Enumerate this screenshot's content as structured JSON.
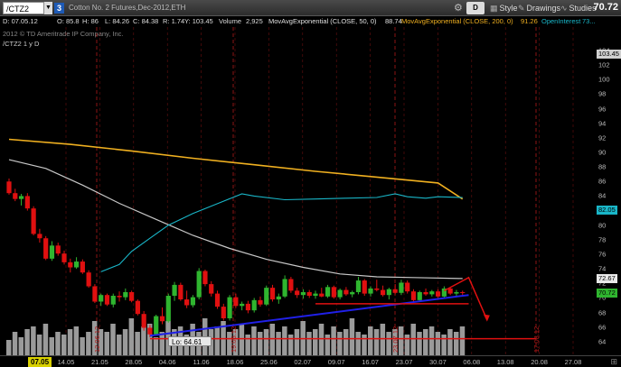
{
  "toolbar": {
    "symbol": "/CTZ2",
    "link_number": "3",
    "description": "Cotton No. 2 Futures,Dec-2012,ETH",
    "period": "D",
    "style_label": "Style",
    "drawings_label": "Drawings",
    "studies_label": "Studies",
    "last_price": "70.72"
  },
  "studybar": {
    "date": "D: 07.05.12",
    "open": "O: 85.8",
    "high": "H: 86",
    "low": "L: 84.26",
    "close": "C: 84.38",
    "range": "R: 1.74",
    "ytd": "Y: 103.45",
    "volume_label": "Volume",
    "volume_value": "2,925",
    "ma50_label": "MovAvgExponential (CLOSE, 50, 0)",
    "ma50_value": "88.74",
    "ma200_label": "MovAvgExponential (CLOSE, 200, 0)",
    "ma200_value": "91.26",
    "oi_label": "OpenInterest",
    "oi_value": "73..."
  },
  "copyright": "2012 © TD Ameritrade IP Company, Inc.",
  "chart_label": "/CTZ2 1 y D",
  "lo_label": "Lo: 64.61",
  "xaxis_first": "07.05",
  "corner_glyph": "⊞",
  "colors": {
    "up": "#2fb52f",
    "down": "#e01010",
    "ma50": "#f0b020",
    "ma200": "#c8c8c8",
    "openinterest": "#19b6c8",
    "trendline": "#2020e8",
    "volume": "#9a9a9a"
  },
  "chart_data": {
    "type": "candlestick",
    "y_range": [
      62,
      104
    ],
    "y_ticks": [
      "104",
      "102",
      "100",
      "98",
      "96",
      "94",
      "92",
      "90",
      "88",
      "86",
      "84",
      "82",
      "80",
      "78",
      "76",
      "74",
      "72",
      "70",
      "68",
      "66",
      "64"
    ],
    "x_ticks": [
      "14.05",
      "21.05",
      "28.05",
      "04.06",
      "11.06",
      "18.06",
      "25.06",
      "02.07",
      "09.07",
      "16.07",
      "23.07",
      "30.07",
      "06.08",
      "13.08",
      "20.08",
      "27.08"
    ],
    "price_tags": [
      {
        "value": 103.45,
        "label": "103.45",
        "bg": "#d0d0d0",
        "fg": "#000"
      },
      {
        "value": 82.05,
        "label": "82.05",
        "bg": "#19b6c8",
        "fg": "#000"
      },
      {
        "value": 72.67,
        "label": "72.67",
        "bg": "#e8e8e8",
        "fg": "#000"
      },
      {
        "value": 70.72,
        "label": "70.72",
        "bg": "#2fb52f",
        "fg": "#000"
      }
    ],
    "event_markers": [
      "12.06.12",
      "19.06.12",
      "23.07.12",
      "17.08.12"
    ],
    "candles": [
      {
        "o": 86.0,
        "h": 86.4,
        "l": 84.2,
        "c": 84.4
      },
      {
        "o": 84.4,
        "h": 85.0,
        "l": 83.3,
        "c": 83.6
      },
      {
        "o": 83.6,
        "h": 84.3,
        "l": 82.7,
        "c": 84.0
      },
      {
        "o": 84.0,
        "h": 84.4,
        "l": 82.0,
        "c": 82.3
      },
      {
        "o": 82.3,
        "h": 82.6,
        "l": 78.6,
        "c": 78.8
      },
      {
        "o": 78.8,
        "h": 79.5,
        "l": 77.6,
        "c": 78.2
      },
      {
        "o": 78.2,
        "h": 78.5,
        "l": 75.2,
        "c": 75.4
      },
      {
        "o": 75.4,
        "h": 77.8,
        "l": 75.1,
        "c": 77.2
      },
      {
        "o": 77.2,
        "h": 77.6,
        "l": 75.8,
        "c": 76.1
      },
      {
        "o": 76.1,
        "h": 76.5,
        "l": 74.6,
        "c": 74.9
      },
      {
        "o": 74.9,
        "h": 75.4,
        "l": 73.5,
        "c": 74.2
      },
      {
        "o": 74.2,
        "h": 75.6,
        "l": 74.0,
        "c": 75.0
      },
      {
        "o": 75.0,
        "h": 75.3,
        "l": 73.3,
        "c": 73.5
      },
      {
        "o": 73.5,
        "h": 73.8,
        "l": 71.4,
        "c": 71.6
      },
      {
        "o": 71.6,
        "h": 71.9,
        "l": 69.3,
        "c": 69.5
      },
      {
        "o": 69.5,
        "h": 70.6,
        "l": 68.9,
        "c": 70.4
      },
      {
        "o": 70.4,
        "h": 70.6,
        "l": 68.9,
        "c": 69.1
      },
      {
        "o": 69.1,
        "h": 70.6,
        "l": 68.7,
        "c": 70.3
      },
      {
        "o": 70.3,
        "h": 70.9,
        "l": 69.5,
        "c": 70.1
      },
      {
        "o": 70.1,
        "h": 71.3,
        "l": 69.7,
        "c": 70.8
      },
      {
        "o": 70.8,
        "h": 71.0,
        "l": 69.4,
        "c": 69.6
      },
      {
        "o": 69.6,
        "h": 69.8,
        "l": 67.6,
        "c": 67.8
      },
      {
        "o": 67.8,
        "h": 68.2,
        "l": 65.5,
        "c": 65.9
      },
      {
        "o": 65.9,
        "h": 66.3,
        "l": 64.61,
        "c": 65.0
      },
      {
        "o": 65.0,
        "h": 67.7,
        "l": 64.8,
        "c": 67.5
      },
      {
        "o": 67.5,
        "h": 68.7,
        "l": 66.4,
        "c": 66.8
      },
      {
        "o": 66.8,
        "h": 70.6,
        "l": 66.6,
        "c": 70.3
      },
      {
        "o": 70.3,
        "h": 72.2,
        "l": 69.6,
        "c": 71.8
      },
      {
        "o": 71.8,
        "h": 72.1,
        "l": 69.6,
        "c": 69.8
      },
      {
        "o": 69.8,
        "h": 71.0,
        "l": 68.6,
        "c": 69.0
      },
      {
        "o": 69.0,
        "h": 70.4,
        "l": 68.7,
        "c": 70.1
      },
      {
        "o": 70.1,
        "h": 74.1,
        "l": 69.8,
        "c": 73.7
      },
      {
        "o": 73.7,
        "h": 73.9,
        "l": 71.6,
        "c": 71.9
      },
      {
        "o": 71.9,
        "h": 72.3,
        "l": 70.2,
        "c": 70.6
      },
      {
        "o": 70.6,
        "h": 71.0,
        "l": 68.5,
        "c": 68.8
      },
      {
        "o": 68.8,
        "h": 69.2,
        "l": 66.9,
        "c": 67.2
      },
      {
        "o": 67.2,
        "h": 70.4,
        "l": 66.9,
        "c": 70.1
      },
      {
        "o": 70.1,
        "h": 70.6,
        "l": 68.6,
        "c": 68.9
      },
      {
        "o": 68.9,
        "h": 69.5,
        "l": 68.3,
        "c": 69.2
      },
      {
        "o": 69.2,
        "h": 69.6,
        "l": 67.9,
        "c": 68.3
      },
      {
        "o": 68.3,
        "h": 70.0,
        "l": 68.0,
        "c": 69.7
      },
      {
        "o": 69.7,
        "h": 70.2,
        "l": 68.8,
        "c": 69.1
      },
      {
        "o": 69.1,
        "h": 71.7,
        "l": 68.9,
        "c": 71.4
      },
      {
        "o": 71.4,
        "h": 71.8,
        "l": 69.5,
        "c": 69.8
      },
      {
        "o": 69.8,
        "h": 70.6,
        "l": 69.2,
        "c": 70.2
      },
      {
        "o": 70.2,
        "h": 73.1,
        "l": 70.0,
        "c": 72.6
      },
      {
        "o": 72.6,
        "h": 72.9,
        "l": 70.7,
        "c": 71.0
      },
      {
        "o": 71.0,
        "h": 71.4,
        "l": 70.0,
        "c": 70.4
      },
      {
        "o": 70.4,
        "h": 71.2,
        "l": 69.9,
        "c": 70.8
      },
      {
        "o": 70.8,
        "h": 71.1,
        "l": 70.0,
        "c": 70.3
      },
      {
        "o": 70.3,
        "h": 71.0,
        "l": 69.9,
        "c": 70.6
      },
      {
        "o": 70.6,
        "h": 71.4,
        "l": 70.1,
        "c": 70.2
      },
      {
        "o": 70.2,
        "h": 71.8,
        "l": 70.0,
        "c": 71.5
      },
      {
        "o": 71.5,
        "h": 71.7,
        "l": 69.9,
        "c": 70.1
      },
      {
        "o": 70.1,
        "h": 71.3,
        "l": 69.8,
        "c": 71.1
      },
      {
        "o": 71.1,
        "h": 71.5,
        "l": 70.3,
        "c": 70.5
      },
      {
        "o": 70.5,
        "h": 71.0,
        "l": 70.1,
        "c": 70.8
      },
      {
        "o": 70.8,
        "h": 72.9,
        "l": 70.5,
        "c": 72.4
      },
      {
        "o": 72.4,
        "h": 72.6,
        "l": 70.3,
        "c": 70.6
      },
      {
        "o": 70.6,
        "h": 71.6,
        "l": 70.2,
        "c": 71.3
      },
      {
        "o": 71.3,
        "h": 72.5,
        "l": 70.9,
        "c": 71.1
      },
      {
        "o": 71.1,
        "h": 71.7,
        "l": 70.2,
        "c": 70.4
      },
      {
        "o": 70.4,
        "h": 71.4,
        "l": 69.8,
        "c": 71.2
      },
      {
        "o": 71.2,
        "h": 71.9,
        "l": 70.5,
        "c": 70.7
      },
      {
        "o": 70.7,
        "h": 72.5,
        "l": 70.4,
        "c": 72.1
      },
      {
        "o": 72.1,
        "h": 72.4,
        "l": 70.6,
        "c": 70.9
      },
      {
        "o": 70.9,
        "h": 71.2,
        "l": 69.4,
        "c": 69.7
      },
      {
        "o": 69.7,
        "h": 71.0,
        "l": 69.5,
        "c": 70.8
      },
      {
        "o": 70.8,
        "h": 71.3,
        "l": 70.3,
        "c": 70.5
      },
      {
        "o": 70.5,
        "h": 71.1,
        "l": 70.2,
        "c": 70.9
      },
      {
        "o": 70.9,
        "h": 71.2,
        "l": 70.0,
        "c": 70.2
      },
      {
        "o": 70.2,
        "h": 71.6,
        "l": 70.0,
        "c": 71.3
      },
      {
        "o": 71.3,
        "h": 71.4,
        "l": 70.4,
        "c": 70.6
      },
      {
        "o": 70.6,
        "h": 71.1,
        "l": 70.1,
        "c": 70.8
      },
      {
        "o": 70.8,
        "h": 71.0,
        "l": 70.2,
        "c": 70.72
      }
    ],
    "volume_bars": [
      6,
      9,
      7,
      10,
      11,
      8,
      12,
      7,
      9,
      8,
      10,
      11,
      7,
      9,
      13,
      10,
      9,
      12,
      8,
      10,
      14,
      9,
      11,
      12,
      7,
      9,
      13,
      10,
      11,
      8,
      12,
      9,
      14,
      10,
      11,
      13,
      9,
      10,
      12,
      8,
      11,
      9,
      10,
      12,
      9,
      11,
      8,
      10,
      13,
      9,
      10,
      12,
      8,
      11,
      9,
      10,
      14,
      9,
      8,
      11,
      10,
      12,
      9,
      10,
      11,
      8,
      12,
      9,
      10,
      11,
      9,
      8,
      10,
      9,
      11
    ],
    "ma200_line": [
      [
        0,
        91.8
      ],
      [
        10,
        91.1
      ],
      [
        20,
        90.2
      ],
      [
        30,
        89.2
      ],
      [
        40,
        88.3
      ],
      [
        50,
        87.4
      ],
      [
        60,
        86.6
      ],
      [
        70,
        85.8
      ],
      [
        74,
        83.6
      ]
    ],
    "ma50_line": [
      [
        0,
        89.0
      ],
      [
        6,
        87.8
      ],
      [
        12,
        85.5
      ],
      [
        18,
        83.0
      ],
      [
        24,
        80.8
      ],
      [
        30,
        78.6
      ],
      [
        36,
        76.8
      ],
      [
        42,
        75.3
      ],
      [
        48,
        74.2
      ],
      [
        54,
        73.3
      ],
      [
        60,
        72.9
      ],
      [
        66,
        72.8
      ],
      [
        74,
        72.67
      ]
    ],
    "oi_line": [
      [
        15,
        73.6
      ],
      [
        18,
        74.6
      ],
      [
        20,
        76.4
      ],
      [
        23,
        78.2
      ],
      [
        26,
        80.0
      ],
      [
        30,
        81.6
      ],
      [
        35,
        83.3
      ],
      [
        38,
        84.3
      ],
      [
        40,
        84.0
      ],
      [
        45,
        83.5
      ],
      [
        50,
        83.6
      ],
      [
        55,
        83.7
      ],
      [
        60,
        83.8
      ],
      [
        63,
        84.3
      ],
      [
        65,
        83.9
      ],
      [
        68,
        83.7
      ],
      [
        70,
        83.9
      ],
      [
        74,
        83.8
      ]
    ],
    "trendlines": [
      {
        "from": [
          23,
          64.8
        ],
        "to": [
          75,
          70.4
        ],
        "color": "blue"
      },
      {
        "from": [
          50,
          69.2
        ],
        "to": [
          75,
          69.2
        ],
        "color": "red"
      },
      {
        "from": [
          23,
          64.4
        ],
        "to": [
          86,
          64.4
        ],
        "color": "red"
      }
    ],
    "projection_arrow": [
      [
        71,
        71.0
      ],
      [
        75,
        72.8
      ],
      [
        78,
        67.0
      ]
    ]
  }
}
